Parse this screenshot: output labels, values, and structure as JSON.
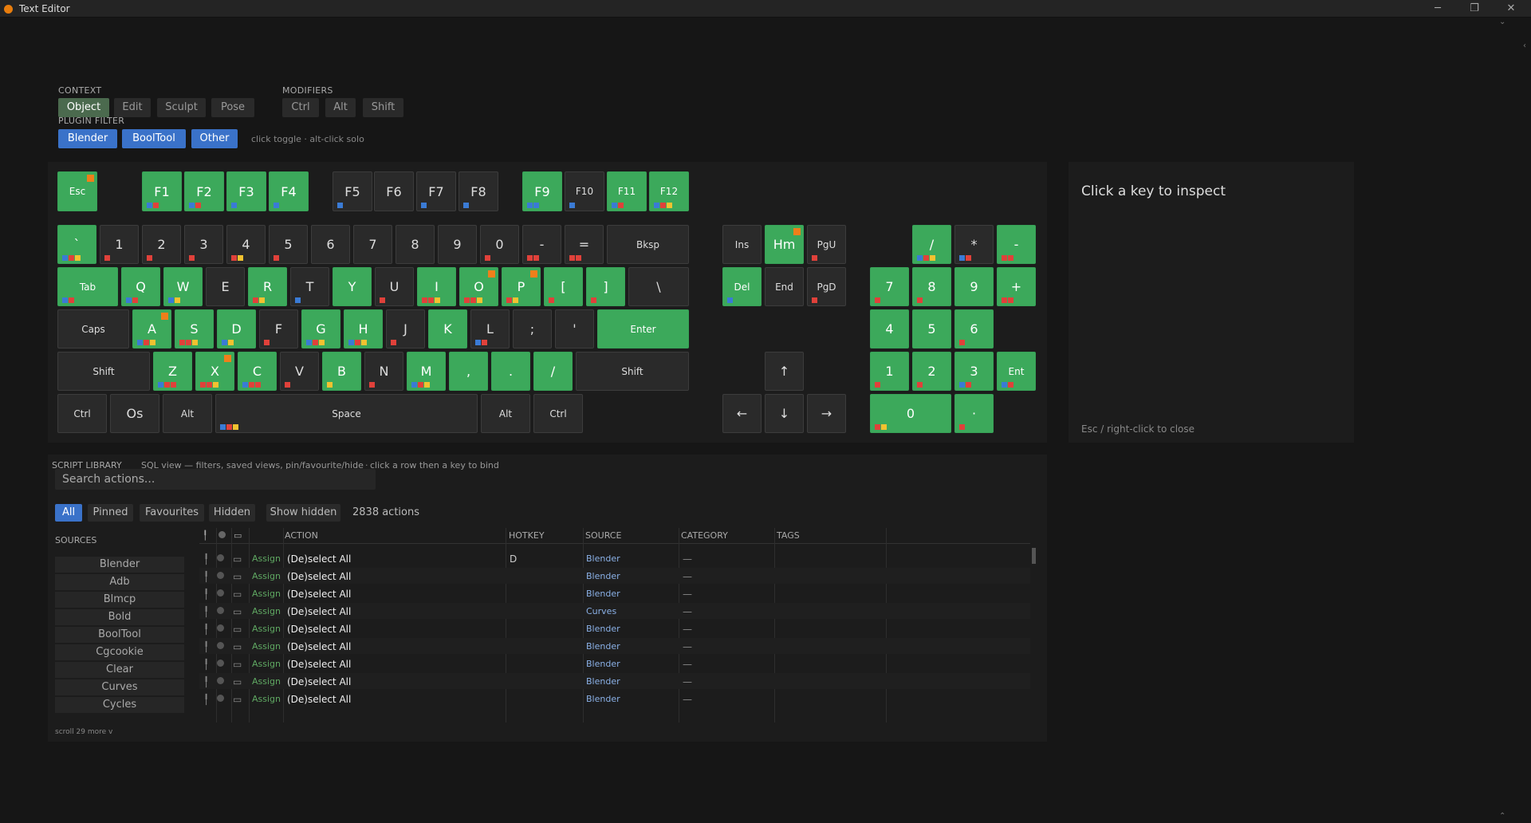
{
  "window": {
    "title": "Text Editor",
    "minimize": "─",
    "maximize": "❐",
    "close": "✕"
  },
  "context": {
    "label": "CONTEXT",
    "items": [
      "Object",
      "Edit",
      "Sculpt",
      "Pose"
    ],
    "active": "Object"
  },
  "modifiers": {
    "label": "MODIFIERS",
    "items": [
      "Ctrl",
      "Alt",
      "Shift"
    ]
  },
  "plugin_filter": {
    "label": "PLUGIN FILTER",
    "items": [
      "Blender",
      "BoolTool",
      "Other"
    ],
    "hint": "click toggle · alt-click solo"
  },
  "colors": {
    "green": "#3ca95b",
    "blue_dot": "#3a7bd5",
    "red_dot": "#e0413a",
    "yellow_dot": "#f2c230",
    "orange": "#ef7f1a",
    "accent": "#3a72c9"
  },
  "keys": {
    "esc": "Esc",
    "f1": "F1",
    "f2": "F2",
    "f3": "F3",
    "f4": "F4",
    "f5": "F5",
    "f6": "F6",
    "f7": "F7",
    "f8": "F8",
    "f9": "F9",
    "f10": "F10",
    "f11": "F11",
    "f12": "F12",
    "grave": "`",
    "n1": "1",
    "n2": "2",
    "n3": "3",
    "n4": "4",
    "n5": "5",
    "n6": "6",
    "n7": "7",
    "n8": "8",
    "n9": "9",
    "n0": "0",
    "minus": "-",
    "equal": "=",
    "bksp": "Bksp",
    "tab": "Tab",
    "q": "Q",
    "w": "W",
    "e": "E",
    "r": "R",
    "t": "T",
    "y": "Y",
    "u": "U",
    "i": "I",
    "o": "O",
    "p": "P",
    "lbr": "[",
    "rbr": "]",
    "bslash": "\\",
    "caps": "Caps",
    "a": "A",
    "s": "S",
    "d": "D",
    "f": "F",
    "g": "G",
    "h": "H",
    "j": "J",
    "k": "K",
    "l": "L",
    "semi": ";",
    "quote": "'",
    "enter": "Enter",
    "lshift": "Shift",
    "z": "Z",
    "x": "X",
    "c": "C",
    "v": "V",
    "b": "B",
    "n": "N",
    "m": "M",
    "comma": ",",
    "period": ".",
    "slash": "/",
    "rshift": "Shift",
    "lctrl": "Ctrl",
    "os": "Os",
    "lalt": "Alt",
    "space": "Space",
    "ralt": "Alt",
    "rctrl": "Ctrl",
    "ins": "Ins",
    "hm": "Hm",
    "pgu": "PgU",
    "del": "Del",
    "end": "End",
    "pgd": "PgD",
    "up": "↑",
    "left": "←",
    "down": "↓",
    "right": "→",
    "np_slash": "/",
    "np_star": "*",
    "np_minus": "-",
    "np7": "7",
    "np8": "8",
    "np9": "9",
    "np_plus": "+",
    "np4": "4",
    "np5": "5",
    "np6": "6",
    "np1": "1",
    "np2": "2",
    "np3": "3",
    "np_ent": "Ent",
    "np0": "0",
    "np_dot": "·"
  },
  "inspector": {
    "heading": "Click a key to inspect",
    "footer": "Esc / right-click to close"
  },
  "library": {
    "title": "SCRIPT LIBRARY",
    "subtitle": "SQL view — filters, saved views, pin/favourite/hide",
    "hint": "click a row then a key to bind",
    "search_placeholder": "Search actions...",
    "tabs": [
      "All",
      "Pinned",
      "Favourites",
      "Hidden",
      "Show hidden"
    ],
    "count": "2838 actions",
    "sources_label": "SOURCES",
    "sources": [
      "Blender",
      "Adb",
      "Blmcp",
      "Bold",
      "BoolTool",
      "Cgcookie",
      "Clear",
      "Curves",
      "Cycles"
    ],
    "scroll_more": "scroll 29 more v",
    "columns": {
      "action": "ACTION",
      "hotkey": "HOTKEY",
      "source": "SOURCE",
      "category": "CATEGORY",
      "tags": "TAGS"
    },
    "rows": [
      {
        "assign": "Assign",
        "action": "(De)select All",
        "hotkey": "D",
        "source": "Blender",
        "category": "—"
      },
      {
        "assign": "Assign",
        "action": "(De)select All",
        "hotkey": "",
        "source": "Blender",
        "category": "—"
      },
      {
        "assign": "Assign",
        "action": "(De)select All",
        "hotkey": "",
        "source": "Blender",
        "category": "—"
      },
      {
        "assign": "Assign",
        "action": "(De)select All",
        "hotkey": "",
        "source": "Curves",
        "category": "—"
      },
      {
        "assign": "Assign",
        "action": "(De)select All",
        "hotkey": "",
        "source": "Blender",
        "category": "—"
      },
      {
        "assign": "Assign",
        "action": "(De)select All",
        "hotkey": "",
        "source": "Blender",
        "category": "—"
      },
      {
        "assign": "Assign",
        "action": "(De)select All",
        "hotkey": "",
        "source": "Blender",
        "category": "—"
      },
      {
        "assign": "Assign",
        "action": "(De)select All",
        "hotkey": "",
        "source": "Blender",
        "category": "—"
      },
      {
        "assign": "Assign",
        "action": "(De)select All",
        "hotkey": "",
        "source": "Blender",
        "category": "—"
      }
    ]
  }
}
